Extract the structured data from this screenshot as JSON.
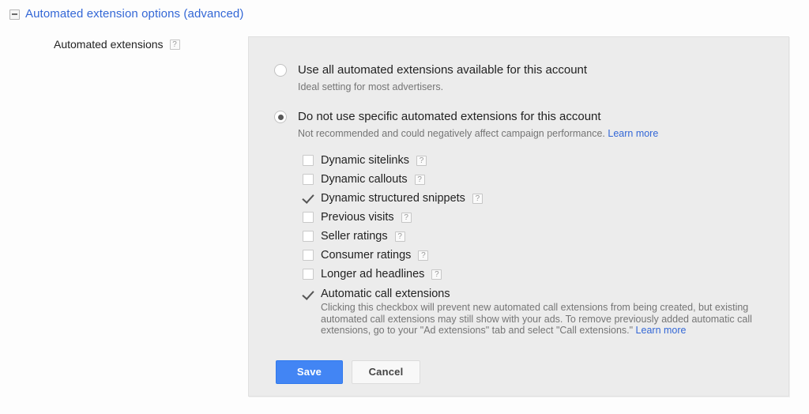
{
  "section": {
    "title": "Automated extension options (advanced)",
    "collapse_icon": "minus-box-icon",
    "expanded": true
  },
  "field": {
    "label": "Automated extensions",
    "help_icon": "?"
  },
  "options": [
    {
      "label": "Use all automated extensions available for this account",
      "description": "Ideal setting for most advertisers.",
      "selected": false,
      "link": null
    },
    {
      "label": "Do not use specific automated extensions for this account",
      "description": "Not recommended and could negatively affect campaign performance.",
      "selected": true,
      "link": "Learn more"
    }
  ],
  "checkboxes": [
    {
      "label": "Dynamic sitelinks",
      "checked": false,
      "help_icon": "?"
    },
    {
      "label": "Dynamic callouts",
      "checked": false,
      "help_icon": "?"
    },
    {
      "label": "Dynamic structured snippets",
      "checked": true,
      "help_icon": "?"
    },
    {
      "label": "Previous visits",
      "checked": false,
      "help_icon": "?"
    },
    {
      "label": "Seller ratings",
      "checked": false,
      "help_icon": "?"
    },
    {
      "label": "Consumer ratings",
      "checked": false,
      "help_icon": "?"
    },
    {
      "label": "Longer ad headlines",
      "checked": false,
      "help_icon": "?"
    }
  ],
  "call_extensions": {
    "label": "Automatic call extensions",
    "checked": true,
    "description": "Clicking this checkbox will prevent new automated call extensions from being created, but existing automated call extensions may still show with your ads. To remove previously added automatic call extensions, go to your \"Ad extensions\" tab and select \"Call extensions.\"",
    "link": "Learn more"
  },
  "buttons": {
    "save_label": "Save",
    "cancel_label": "Cancel"
  },
  "colors": {
    "link": "#3367d6",
    "primary_button": "#4285f4",
    "panel_background": "#ececec"
  }
}
